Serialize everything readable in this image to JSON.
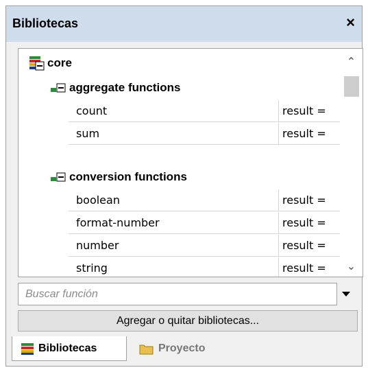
{
  "window": {
    "title": "Bibliotecas",
    "close_glyph": "×"
  },
  "tree": {
    "root": {
      "label": "core"
    },
    "groups": [
      {
        "label": "aggregate functions",
        "functions": [
          {
            "name": "count",
            "result": "result ="
          },
          {
            "name": "sum",
            "result": "result ="
          }
        ]
      },
      {
        "label": "conversion functions",
        "functions": [
          {
            "name": "boolean",
            "result": "result ="
          },
          {
            "name": "format-number",
            "result": "result ="
          },
          {
            "name": "number",
            "result": "result ="
          },
          {
            "name": "string",
            "result": "result ="
          }
        ]
      }
    ]
  },
  "search": {
    "placeholder": "Buscar función"
  },
  "button": {
    "label": "Agregar o quitar bibliotecas..."
  },
  "tabs": [
    {
      "label": "Bibliotecas",
      "active": true
    },
    {
      "label": "Proyecto",
      "active": false
    }
  ],
  "colors": {
    "titlebar": "#cfdcec",
    "accent": "#c9a44a"
  }
}
